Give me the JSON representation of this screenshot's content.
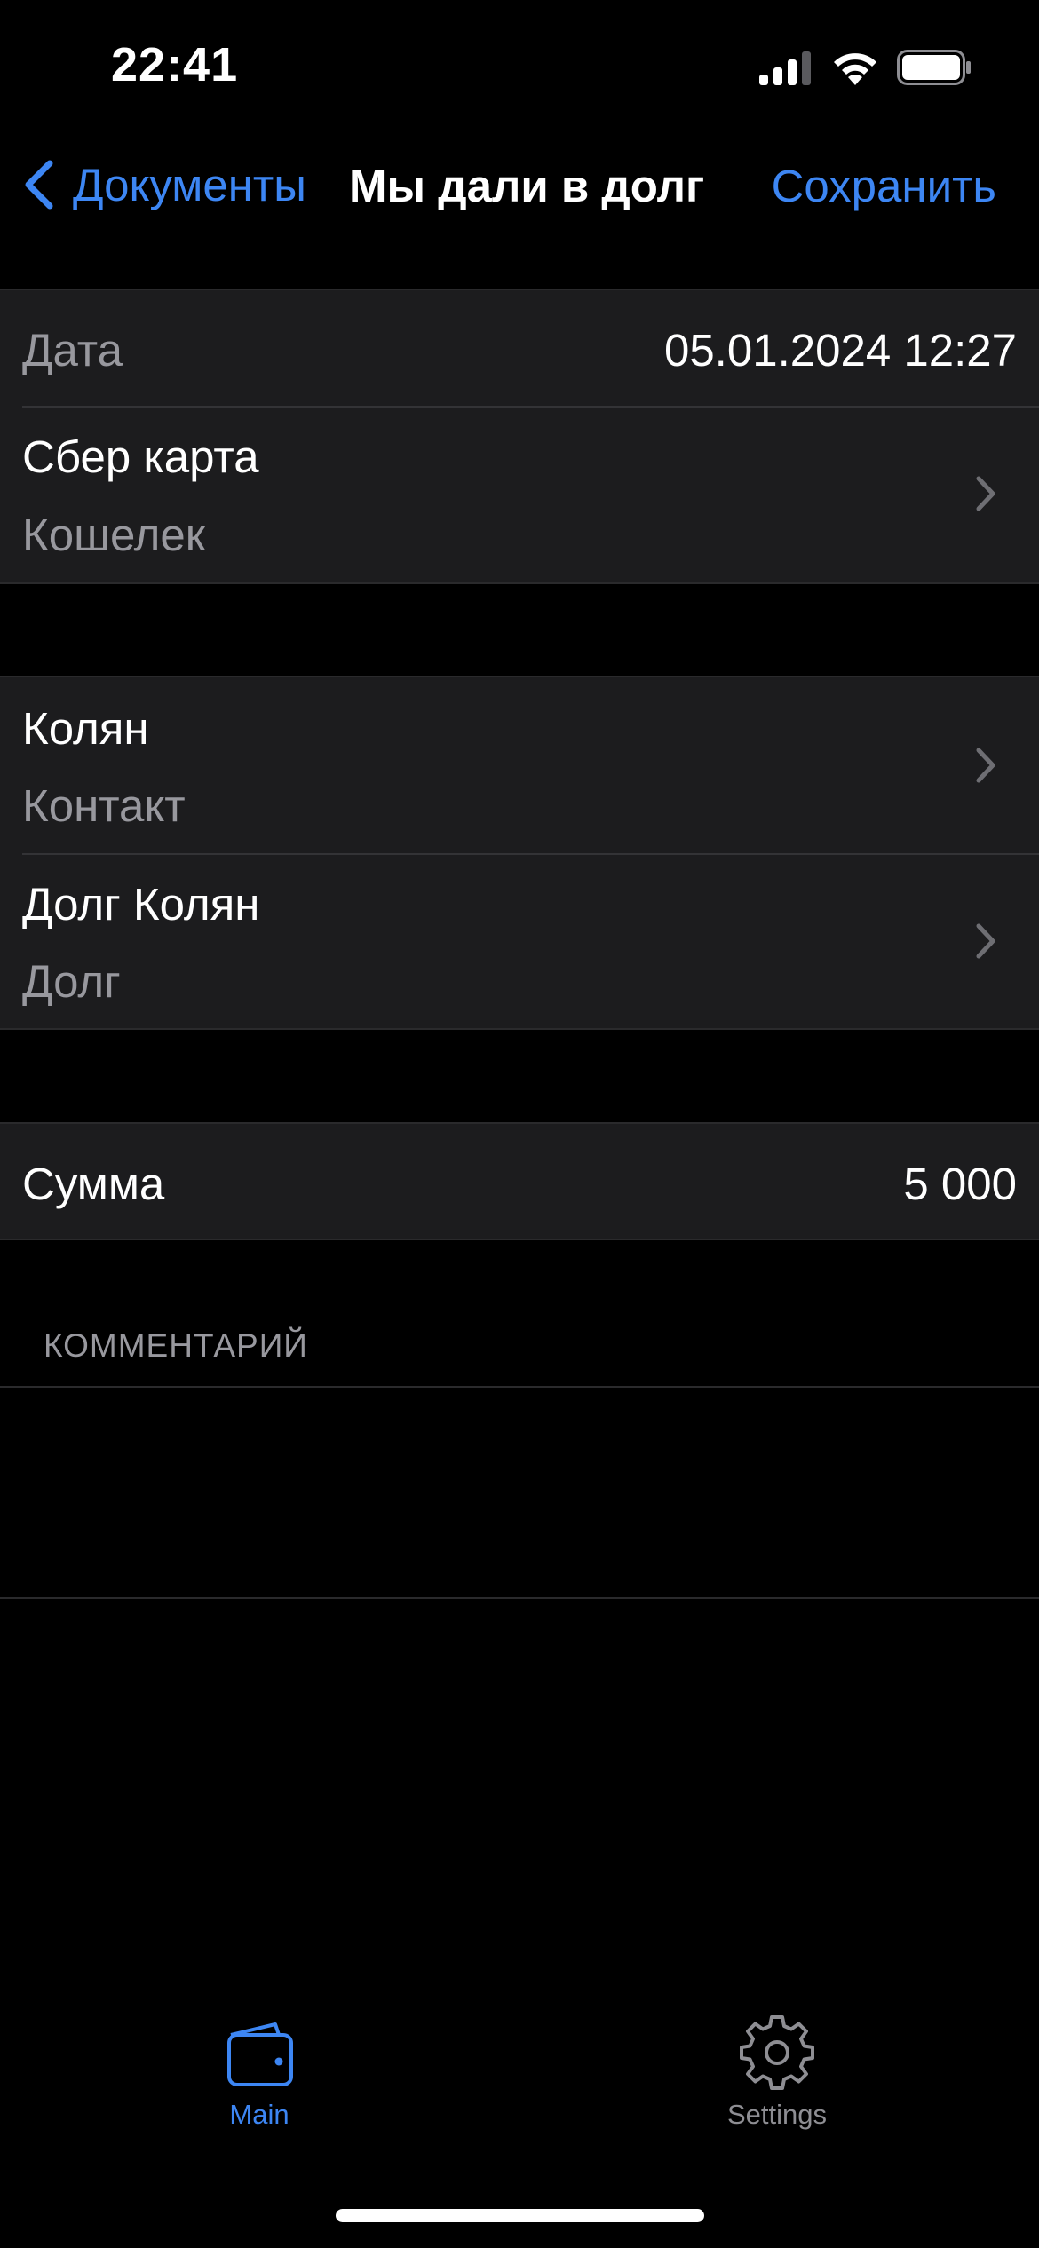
{
  "status_bar": {
    "time": "22:41",
    "icons": [
      "signal-icon",
      "wifi-icon",
      "battery-icon"
    ]
  },
  "nav": {
    "back_label": "Документы",
    "title": "Мы дали в долг",
    "save_label": "Сохранить"
  },
  "section1": {
    "date_label": "Дата",
    "date_value": "05.01.2024 12:27",
    "wallet_title": "Сбер карта",
    "wallet_subtitle": "Кошелек"
  },
  "section2": {
    "contact_title": "Колян",
    "contact_subtitle": "Контакт",
    "debt_title": "Долг Колян",
    "debt_subtitle": "Долг"
  },
  "section3": {
    "amount_label": "Сумма",
    "amount_value": "5 000"
  },
  "comment": {
    "header": "КОММЕНТАРИЙ",
    "value": ""
  },
  "tab_bar": {
    "tabs": [
      {
        "label": "Main",
        "icon": "wallet-icon",
        "selected": true
      },
      {
        "label": "Settings",
        "icon": "gear-icon",
        "selected": false
      }
    ]
  },
  "colors": {
    "accent": "#3d86f3",
    "background": "#000000",
    "cell_background": "#1c1c1e",
    "secondary_text": "#98989e"
  }
}
